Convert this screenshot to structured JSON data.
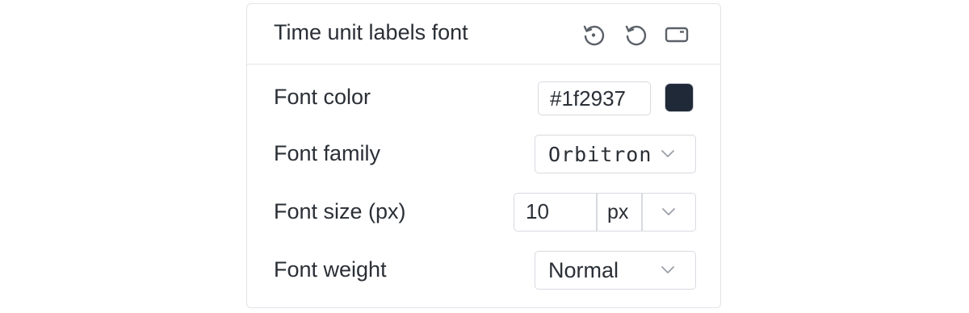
{
  "panel": {
    "title": "Time unit labels font",
    "header_icons": [
      "reset-to-default-icon",
      "undo-icon",
      "collapse-panel-icon"
    ]
  },
  "font_color": {
    "label": "Font color",
    "value": "#1f2937",
    "swatch_color": "#1f2937"
  },
  "font_family": {
    "label": "Font family",
    "value": "Orbitron"
  },
  "font_size": {
    "label": "Font size (px)",
    "value": "10",
    "unit": "px"
  },
  "font_weight": {
    "label": "Font weight",
    "value": "Normal"
  }
}
